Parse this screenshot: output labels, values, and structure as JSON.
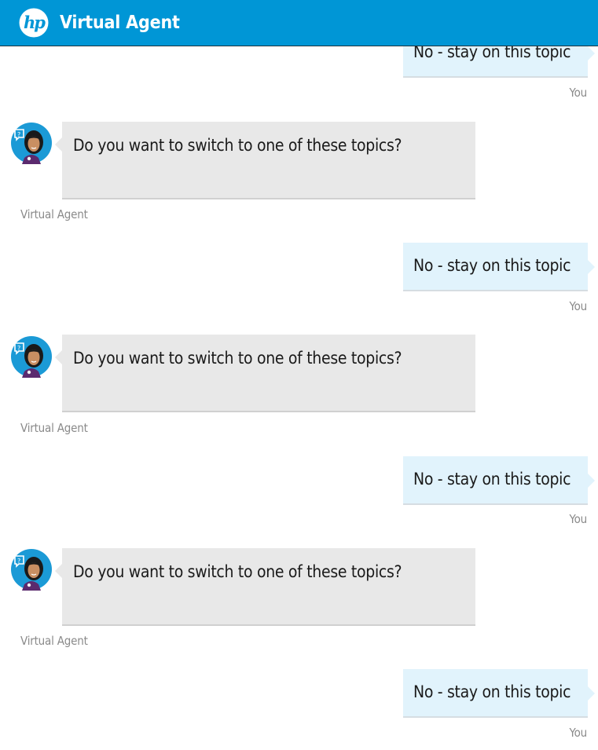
{
  "header": {
    "logo_text": "hp",
    "title": "Virtual Agent"
  },
  "colors": {
    "header_bg": "#0096d6",
    "user_bubble": "#e1f3fc",
    "agent_bubble": "#e8e8e8",
    "sender_label": "#8a8a8a"
  },
  "messages": [
    {
      "from": "user",
      "text": "No - stay on this topic",
      "sender": "You"
    },
    {
      "from": "agent",
      "text": "Do you want to switch to one of these topics?",
      "sender": "Virtual Agent",
      "avatar": "virtual-agent-avatar-icon"
    },
    {
      "from": "user",
      "text": "No - stay on this topic",
      "sender": "You"
    },
    {
      "from": "agent",
      "text": "Do you want to switch to one of these topics?",
      "sender": "Virtual Agent",
      "avatar": "virtual-agent-avatar-icon"
    },
    {
      "from": "user",
      "text": "No - stay on this topic",
      "sender": "You"
    },
    {
      "from": "agent",
      "text": "Do you want to switch to one of these topics?",
      "sender": "Virtual Agent",
      "avatar": "virtual-agent-avatar-icon"
    },
    {
      "from": "user",
      "text": "No - stay on this topic",
      "sender": "You"
    }
  ]
}
